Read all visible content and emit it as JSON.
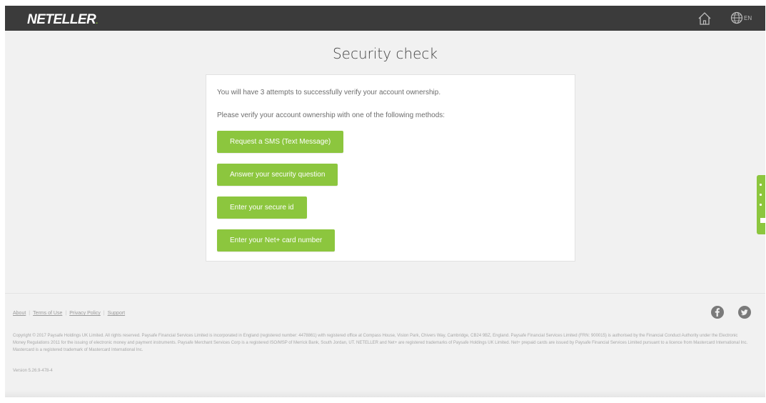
{
  "header": {
    "logo_text": "NETELLER",
    "logo_dot": ".",
    "language": "EN",
    "icons": [
      "home-icon",
      "globe-icon"
    ]
  },
  "main": {
    "title": "Security check",
    "attempts_text": "You will have 3 attempts to successfully verify your account ownership.",
    "instruction_text": "Please verify your account ownership with one of the following methods:",
    "buttons": [
      {
        "label": "Request a SMS (Text Message)"
      },
      {
        "label": "Answer your security question"
      },
      {
        "label": "Enter your secure id"
      },
      {
        "label": "Enter your Net+ card number"
      }
    ]
  },
  "footer": {
    "links": [
      "About",
      "Terms of Use",
      "Privacy Policy",
      "Support"
    ],
    "social_icons": [
      "facebook-icon",
      "twitter-icon"
    ],
    "copyright": "Copyright © 2017 Paysafe Holdings UK Limited. All rights reserved. Paysafe Financial Services Limited is incorporated in England (registered number: 4478861) with registered office at Compass House, Vision Park, Chivers Way, Cambridge, CB24 9BZ, England. Paysafe Financial Services Limited (FRN: 900015) is authorised by the Financial Conduct Authority under the Electronic Money Regulations 2011 for the issuing of electronic money and payment instruments. Paysafe Merchant Services Corp is a registered ISO/MSP of Merrick Bank, South Jordan, UT. NETELLER and Net+ are registered trademarks of Paysafe Holdings UK Limited. Net+ prepaid cards are issued by Paysafe Financial Services Limited pursuant to a licence from Mastercard International Inc. Mastercard is a registered trademark of Mastercard International Inc.",
    "version": "Version 5.26.9-478-4"
  },
  "colors": {
    "accent_green": "#8cc63e",
    "topbar": "#3b3b3b",
    "background": "#f1f1f1"
  }
}
